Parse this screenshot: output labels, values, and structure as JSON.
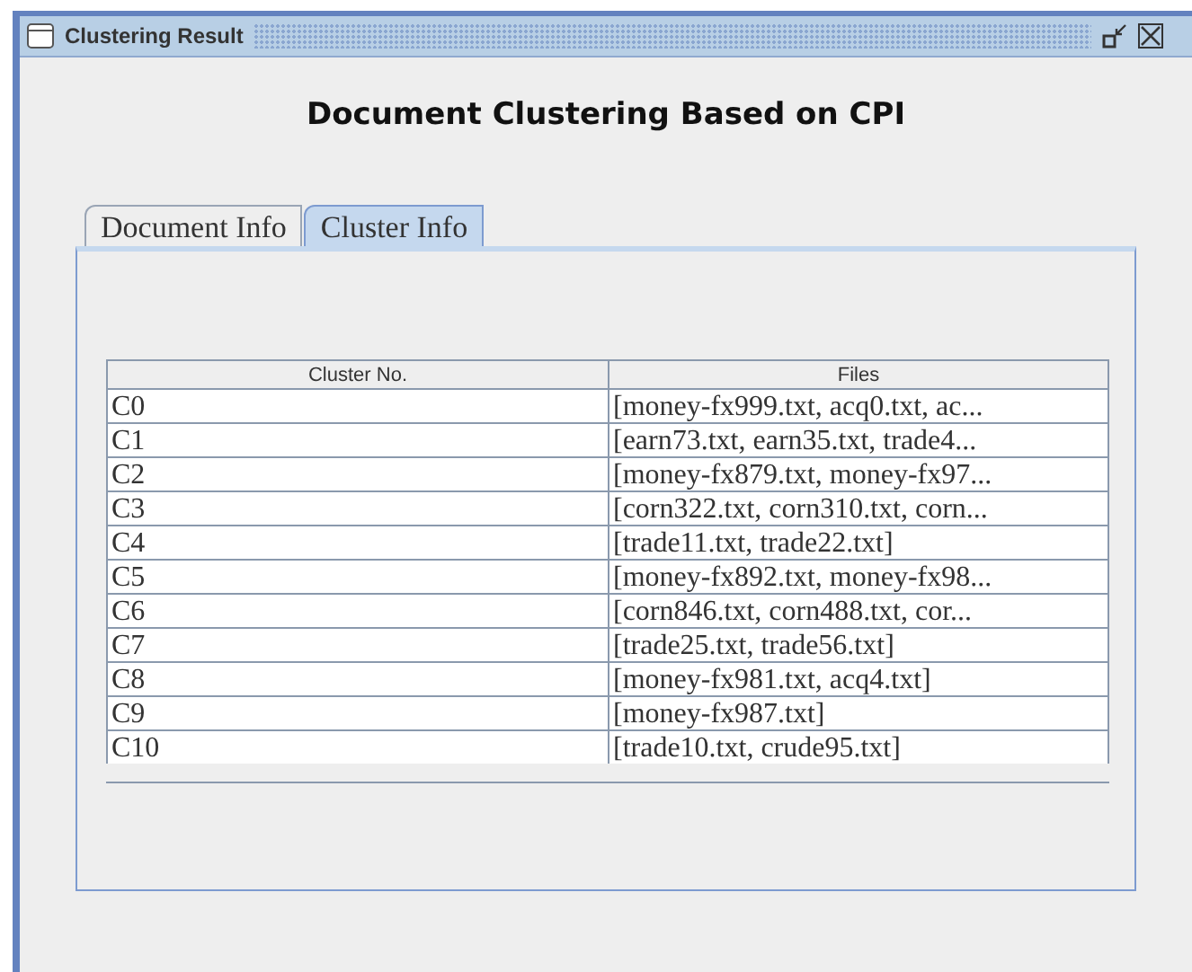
{
  "window": {
    "title": "Clustering Result"
  },
  "heading": "Document Clustering Based on CPI",
  "tabs": [
    {
      "label": "Document Info",
      "selected": false
    },
    {
      "label": "Cluster Info",
      "selected": true
    }
  ],
  "table": {
    "columns": [
      "Cluster No.",
      "Files"
    ],
    "rows": [
      [
        "C0",
        "[money-fx999.txt, acq0.txt, ac..."
      ],
      [
        "C1",
        "[earn73.txt, earn35.txt, trade4..."
      ],
      [
        "C2",
        "[money-fx879.txt, money-fx97..."
      ],
      [
        "C3",
        "[corn322.txt, corn310.txt, corn..."
      ],
      [
        "C4",
        "[trade11.txt, trade22.txt]"
      ],
      [
        "C5",
        "[money-fx892.txt, money-fx98..."
      ],
      [
        "C6",
        "[corn846.txt, corn488.txt, cor..."
      ],
      [
        "C7",
        "[trade25.txt, trade56.txt]"
      ],
      [
        "C8",
        "[money-fx981.txt, acq4.txt]"
      ],
      [
        "C9",
        "[money-fx987.txt]"
      ],
      [
        "C10",
        "[trade10.txt, crude95.txt]"
      ]
    ]
  }
}
